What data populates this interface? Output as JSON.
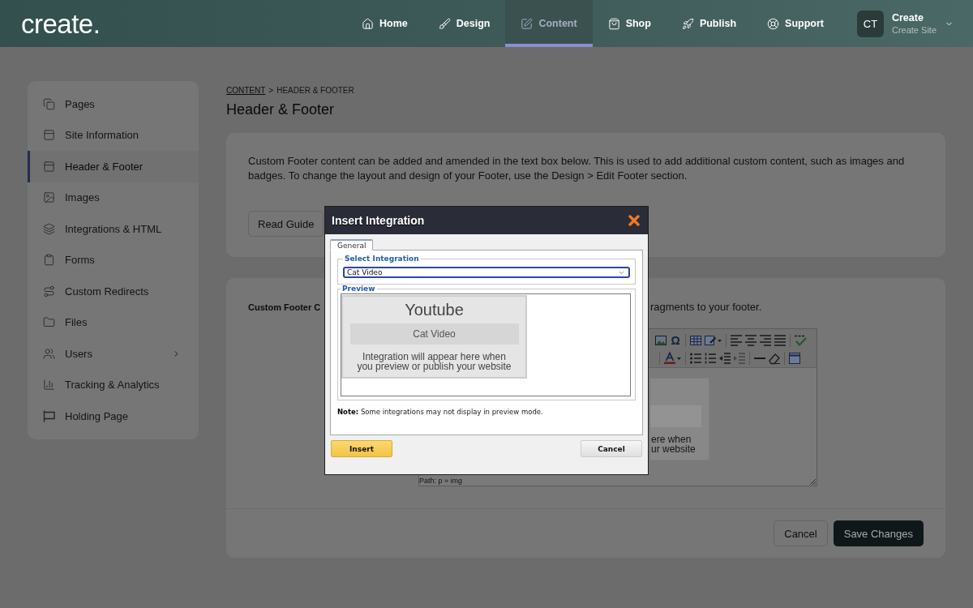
{
  "nav": {
    "logo": "create.",
    "items": [
      {
        "label": "Home",
        "selected": false
      },
      {
        "label": "Design",
        "selected": false
      },
      {
        "label": "Content",
        "selected": true
      },
      {
        "label": "Shop",
        "selected": false
      },
      {
        "label": "Publish",
        "selected": false
      },
      {
        "label": "Support",
        "selected": false
      }
    ],
    "account": {
      "initials": "CT",
      "name": "Create",
      "site": "Create Site"
    }
  },
  "sidebar": {
    "items": [
      {
        "label": "Pages",
        "selected": false,
        "expandable": false
      },
      {
        "label": "Site Information",
        "selected": false,
        "expandable": false
      },
      {
        "label": "Header & Footer",
        "selected": true,
        "expandable": false
      },
      {
        "label": "Images",
        "selected": false,
        "expandable": false
      },
      {
        "label": "Integrations & HTML",
        "selected": false,
        "expandable": false
      },
      {
        "label": "Forms",
        "selected": false,
        "expandable": false
      },
      {
        "label": "Custom Redirects",
        "selected": false,
        "expandable": false
      },
      {
        "label": "Files",
        "selected": false,
        "expandable": false
      },
      {
        "label": "Users",
        "selected": false,
        "expandable": true
      },
      {
        "label": "Tracking & Analytics",
        "selected": false,
        "expandable": false
      },
      {
        "label": "Holding Page",
        "selected": false,
        "expandable": false
      }
    ]
  },
  "breadcrumb": {
    "parent": "CONTENT",
    "separator": ">",
    "current": "HEADER & FOOTER"
  },
  "title": "Header & Footer",
  "info_card": {
    "text": "Custom Footer content can be added and amended in the text box below. This is used to add additional custom content, such as images and badges. To change the layout and design of your Footer, use the Design > Edit Footer section.",
    "button": "Read Guide"
  },
  "footer_card": {
    "label": "Custom Footer C",
    "description": "ragments to your footer.",
    "editor": {
      "symbol": "Ω",
      "preview_lines": [
        "ere when",
        "ur website"
      ],
      "path": "Path: p » img"
    },
    "buttons": [
      {
        "label": "Cancel",
        "kind": "secondary"
      },
      {
        "label": "Save Changes",
        "kind": "primary"
      }
    ]
  },
  "dialog": {
    "title": "Insert Integration",
    "tabs": [
      {
        "label": "General",
        "selected": true
      }
    ],
    "select": {
      "legend": "Select Integration",
      "value": "Cat Video"
    },
    "preview": {
      "legend": "Preview",
      "heading": "Youtube",
      "name": "Cat Video",
      "message_lines": [
        "Integration will appear here when",
        "you preview or publish your website"
      ]
    },
    "note": "**Note:** Some integrations may not display in preview mode.",
    "buttons": [
      {
        "label": "Insert",
        "kind": "primary"
      },
      {
        "label": "Cancel",
        "kind": "secondary"
      }
    ]
  }
}
